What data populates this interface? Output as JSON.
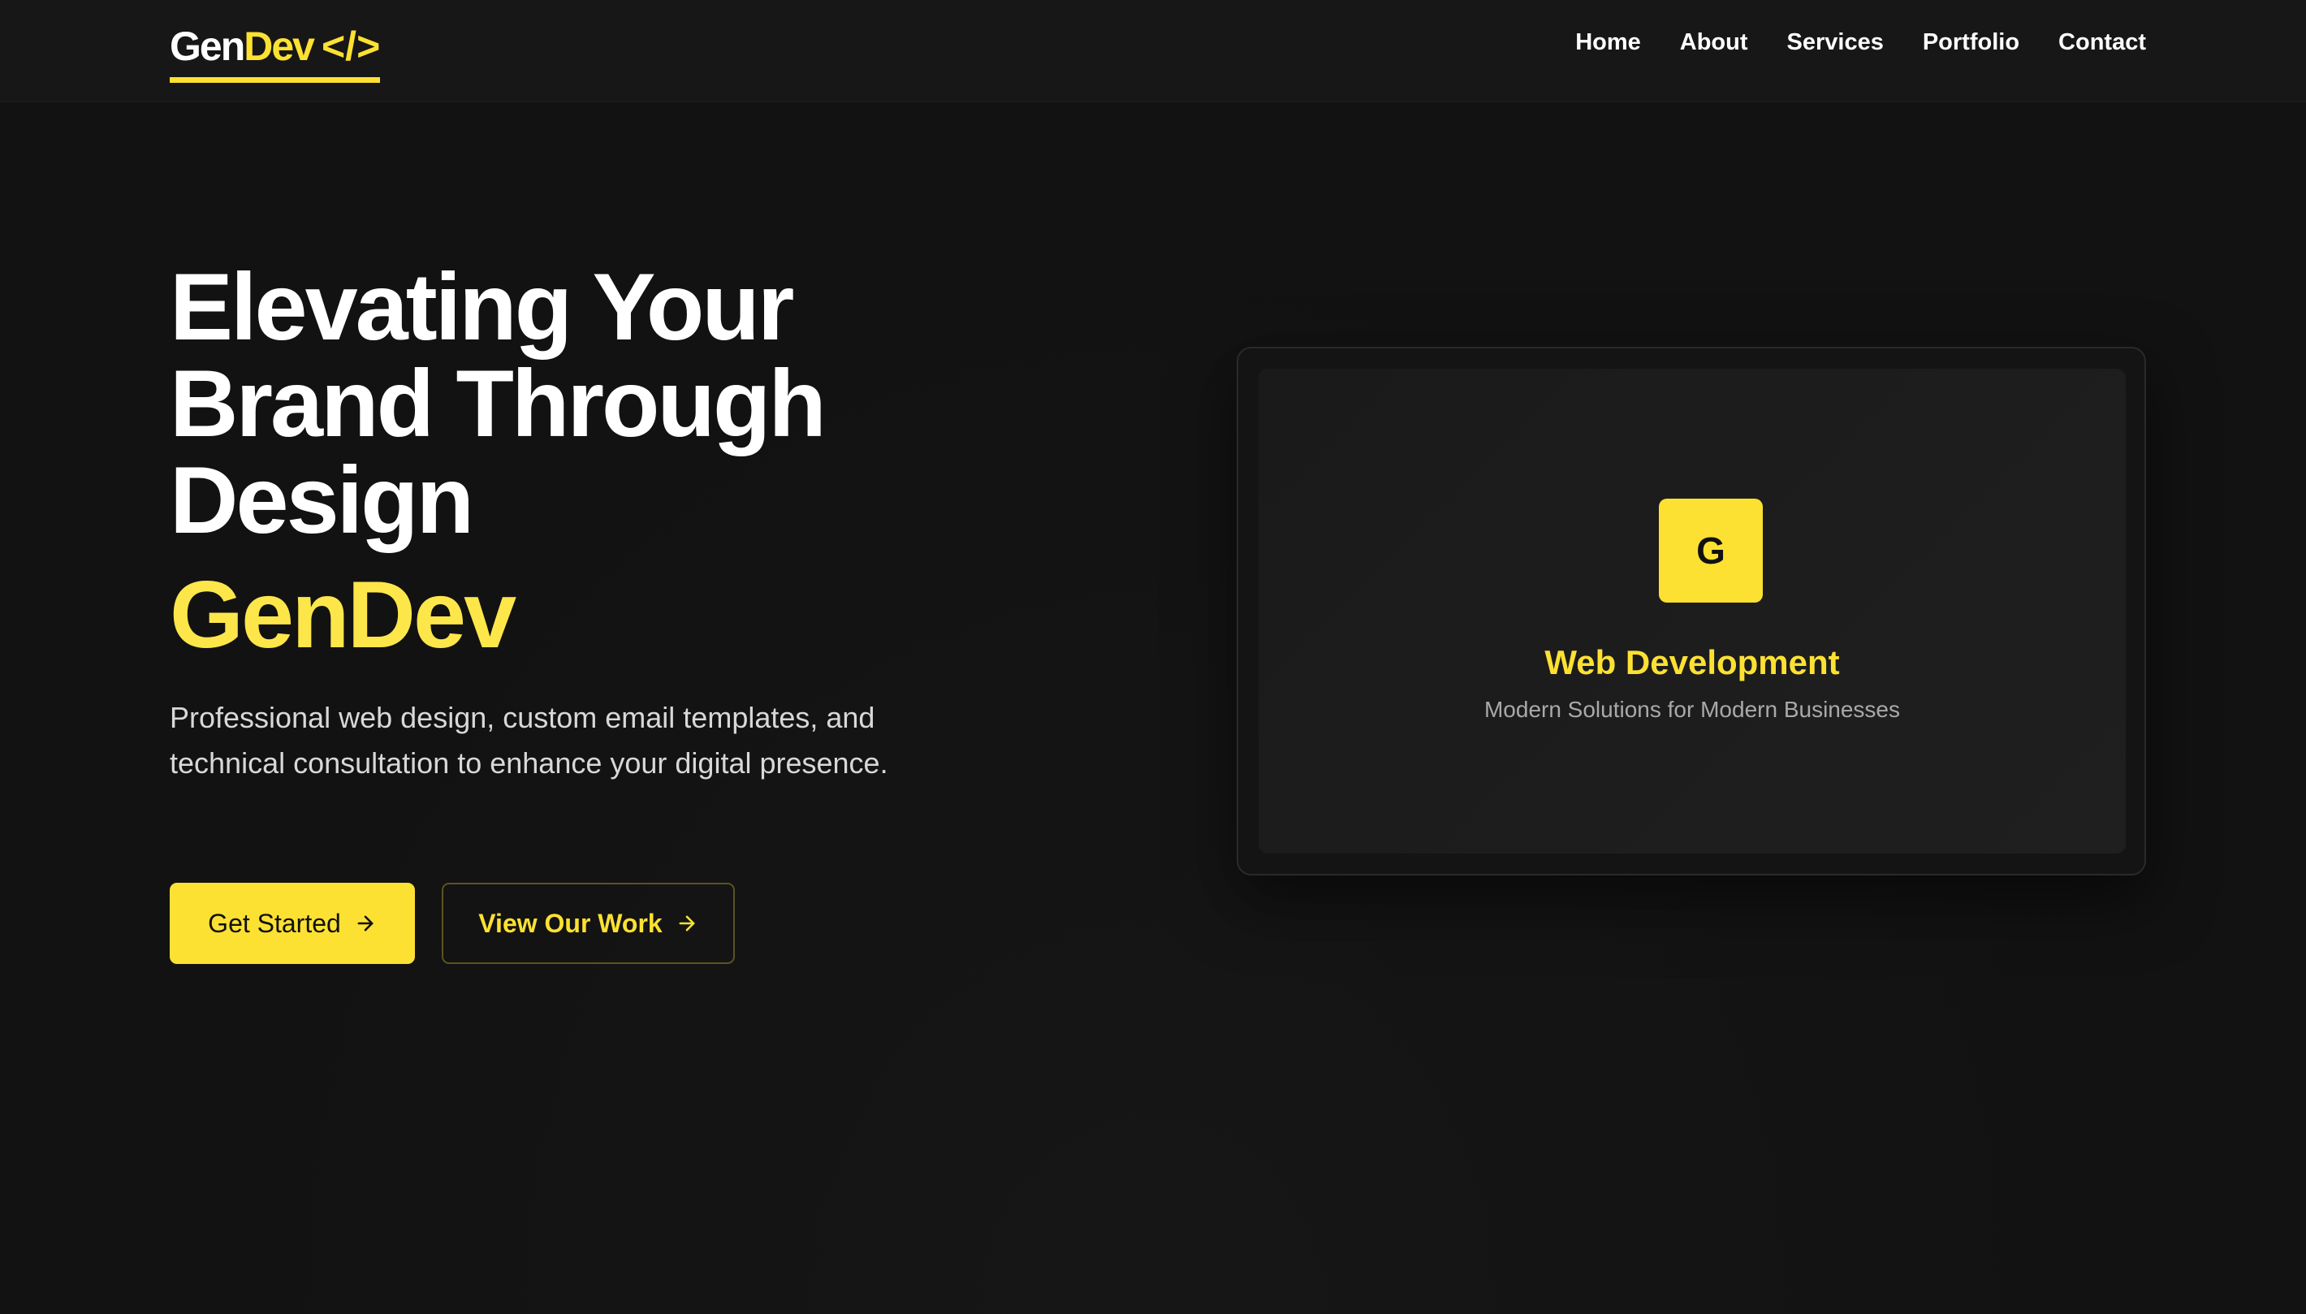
{
  "logo": {
    "part1": "Gen",
    "part2": "Dev",
    "code": "</>"
  },
  "nav": {
    "items": [
      {
        "label": "Home"
      },
      {
        "label": "About"
      },
      {
        "label": "Services"
      },
      {
        "label": "Portfolio"
      },
      {
        "label": "Contact"
      }
    ]
  },
  "hero": {
    "title_line1": "Elevating Your",
    "title_line2": "Brand Through",
    "title_line3": "Design",
    "brand": "GenDev",
    "description": "Professional web design, custom email templates, and technical consultation to enhance your digital presence.",
    "primary_button": "Get Started",
    "secondary_button": "View Our Work",
    "button_icon": "arrow-right-icon"
  },
  "card": {
    "badge_letter": "G",
    "title": "Web Development",
    "subtitle": "Modern Solutions for Modern Businesses"
  },
  "colors": {
    "background": "#121212",
    "navbar": "#171717",
    "accent": "#fde132",
    "text": "#ffffff",
    "muted": "#a9a9a9"
  }
}
